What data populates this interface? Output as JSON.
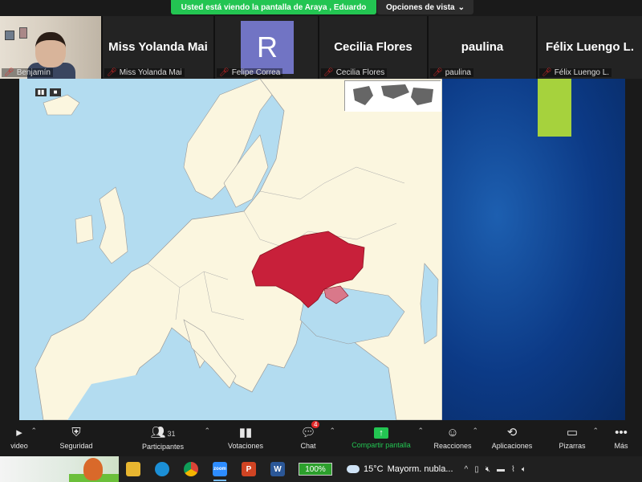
{
  "banner": {
    "share_text": "Usted está viendo la pantalla de Araya , Eduardo",
    "view_options": "Opciones de vista"
  },
  "participants": [
    {
      "display": "",
      "label": "Benjamín"
    },
    {
      "display": "Miss Yolanda Mai",
      "label": "Miss Yolanda Mai"
    },
    {
      "display": "R",
      "label": "Felipe Correa"
    },
    {
      "display": "Cecilia Flores",
      "label": "Cecilia Flores"
    },
    {
      "display": "paulina",
      "label": "paulina"
    },
    {
      "display": "Félix Luengo L.",
      "label": "Félix Luengo L."
    }
  ],
  "colors": {
    "share_green": "#23c552",
    "ukraine_red": "#c8203a",
    "avatar_purple": "#7174c4",
    "muted_red": "#e02828"
  },
  "toolbar": {
    "video": "video",
    "security": "Seguridad",
    "participants": "Participantes",
    "participants_count": "31",
    "polls": "Votaciones",
    "chat": "Chat",
    "chat_badge": "4",
    "share": "Compartir pantalla",
    "reactions": "Reacciones",
    "apps": "Aplicaciones",
    "whiteboards": "Pizarras",
    "more": "Más"
  },
  "taskbar": {
    "battery": "100%",
    "temperature": "15°C",
    "weather": "Mayorm. nubla...",
    "apps": [
      {
        "name": "file-explorer-icon",
        "glyph": ""
      },
      {
        "name": "edge-icon",
        "glyph": ""
      },
      {
        "name": "chrome-icon",
        "glyph": ""
      },
      {
        "name": "zoom-icon",
        "glyph": "zoom"
      },
      {
        "name": "powerpoint-icon",
        "glyph": "P"
      },
      {
        "name": "word-icon",
        "glyph": "W"
      }
    ]
  }
}
